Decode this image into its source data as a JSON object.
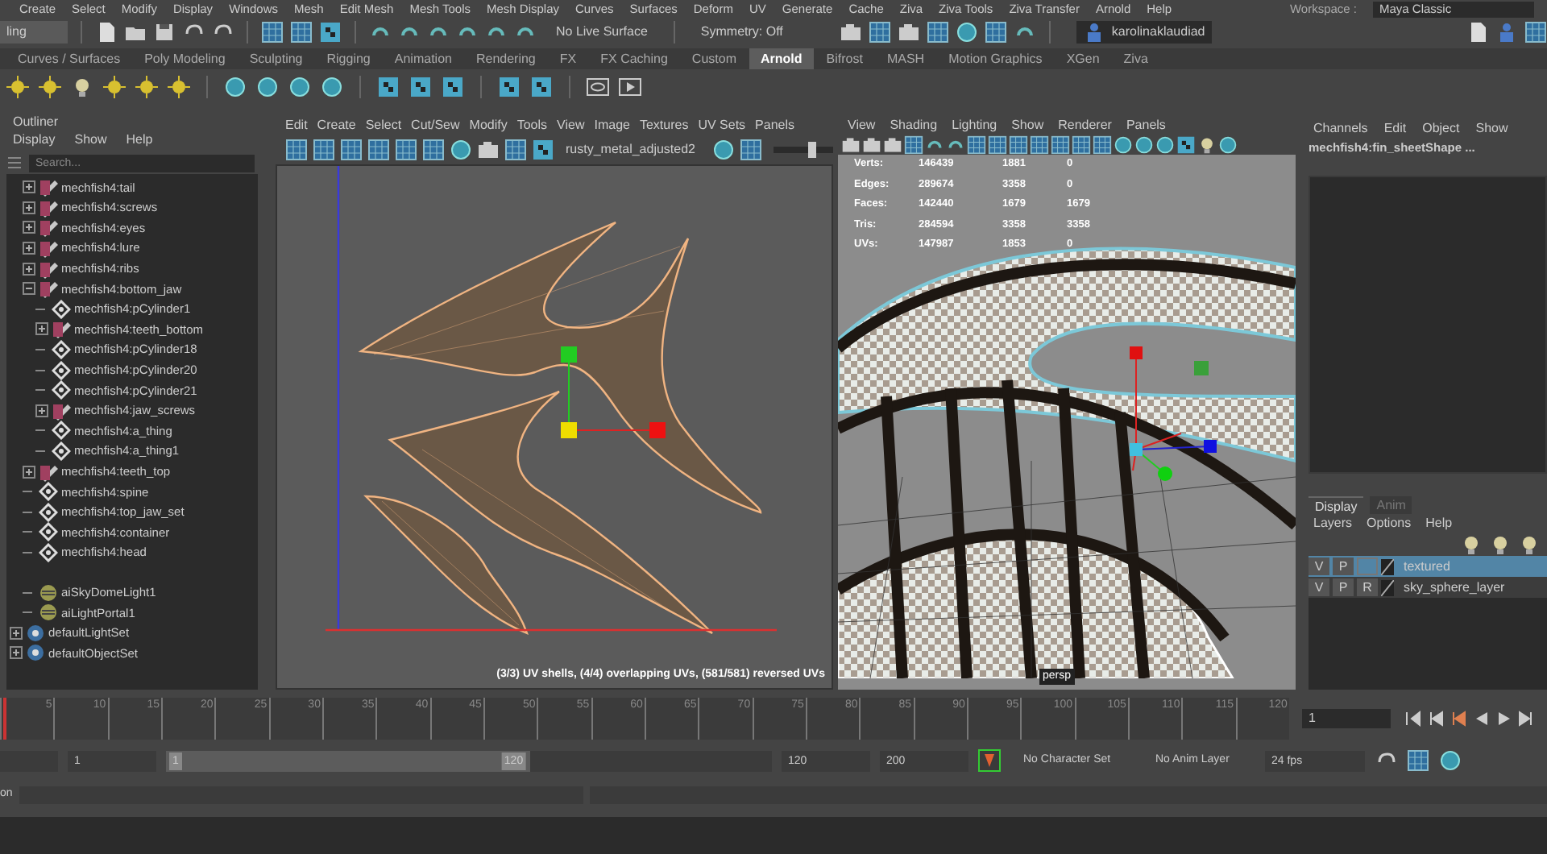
{
  "menu_bar": {
    "items": [
      "Create",
      "Select",
      "Modify",
      "Display",
      "Windows",
      "Mesh",
      "Edit Mesh",
      "Mesh Tools",
      "Mesh Display",
      "Curves",
      "Surfaces",
      "Deform",
      "UV",
      "Generate",
      "Cache",
      "Ziva",
      "Ziva Tools",
      "Ziva Transfer",
      "Arnold",
      "Help"
    ],
    "workspace_label": "Workspace :",
    "workspace": "Maya Classic"
  },
  "status_line": {
    "mode": "ling",
    "live_surface": "No Live Surface",
    "symmetry": "Symmetry: Off",
    "user": "karolinaklaudiad"
  },
  "shelf_tabs": [
    {
      "label": "Curves / Surfaces",
      "selected": false
    },
    {
      "label": "Poly Modeling",
      "selected": false
    },
    {
      "label": "Sculpting",
      "selected": false
    },
    {
      "label": "Rigging",
      "selected": false
    },
    {
      "label": "Animation",
      "selected": false
    },
    {
      "label": "Rendering",
      "selected": false
    },
    {
      "label": "FX",
      "selected": false
    },
    {
      "label": "FX Caching",
      "selected": false
    },
    {
      "label": "Custom",
      "selected": false
    },
    {
      "label": "Arnold",
      "selected": true
    },
    {
      "label": "Bifrost",
      "selected": false
    },
    {
      "label": "MASH",
      "selected": false
    },
    {
      "label": "Motion Graphics",
      "selected": false
    },
    {
      "label": "XGen",
      "selected": false
    },
    {
      "label": "Ziva",
      "selected": false
    }
  ],
  "outliner": {
    "title": "Outliner",
    "menu": [
      "Display",
      "Show",
      "Help"
    ],
    "search": {
      "placeholder": "Search..."
    },
    "items": [
      {
        "label": "mechfish4:tail",
        "kind": "group"
      },
      {
        "label": "mechfish4:screws",
        "kind": "group"
      },
      {
        "label": "mechfish4:eyes",
        "kind": "group"
      },
      {
        "label": "mechfish4:lure",
        "kind": "group"
      },
      {
        "label": "mechfish4:ribs",
        "kind": "group"
      },
      {
        "label": "mechfish4:bottom_jaw",
        "kind": "group",
        "expanded": true,
        "children": [
          {
            "label": "mechfish4:pCylinder1",
            "kind": "mesh"
          },
          {
            "label": "mechfish4:teeth_bottom",
            "kind": "group"
          },
          {
            "label": "mechfish4:pCylinder18",
            "kind": "mesh"
          },
          {
            "label": "mechfish4:pCylinder20",
            "kind": "mesh"
          },
          {
            "label": "mechfish4:pCylinder21",
            "kind": "mesh"
          },
          {
            "label": "mechfish4:jaw_screws",
            "kind": "group"
          },
          {
            "label": "mechfish4:a_thing",
            "kind": "mesh"
          },
          {
            "label": "mechfish4:a_thing1",
            "kind": "mesh"
          }
        ]
      },
      {
        "label": "mechfish4:teeth_top",
        "kind": "group"
      },
      {
        "label": "mechfish4:spine",
        "kind": "mesh"
      },
      {
        "label": "mechfish4:top_jaw_set",
        "kind": "mesh"
      },
      {
        "label": "mechfish4:container",
        "kind": "mesh"
      },
      {
        "label": "mechfish4:head",
        "kind": "mesh"
      }
    ],
    "root_items": [
      {
        "label": "aiSkyDomeLight1",
        "kind": "light"
      },
      {
        "label": "aiLightPortal1",
        "kind": "light"
      },
      {
        "label": "defaultLightSet",
        "kind": "set"
      },
      {
        "label": "defaultObjectSet",
        "kind": "set"
      }
    ]
  },
  "uv_editor": {
    "menu": [
      "Edit",
      "Create",
      "Select",
      "Cut/Sew",
      "Modify",
      "Tools",
      "View",
      "Image",
      "Textures",
      "UV Sets",
      "Panels"
    ],
    "texture": "rusty_metal_adjusted2",
    "exposure_slider": {
      "level": 0.65
    },
    "status": "(3/3) UV shells, (4/4) overlapping UVs, (581/581) reversed UVs"
  },
  "viewport": {
    "menu": [
      "View",
      "Shading",
      "Lighting",
      "Show",
      "Renderer",
      "Panels"
    ],
    "hud": [
      {
        "label": "Verts:",
        "values": [
          "146439",
          "1881",
          "0"
        ]
      },
      {
        "label": "Edges:",
        "values": [
          "289674",
          "3358",
          "0"
        ]
      },
      {
        "label": "Faces:",
        "values": [
          "142440",
          "1679",
          "1679"
        ]
      },
      {
        "label": "Tris:",
        "values": [
          "284594",
          "3358",
          "3358"
        ]
      },
      {
        "label": "UVs:",
        "values": [
          "147987",
          "1853",
          "0"
        ]
      }
    ],
    "camera": "persp"
  },
  "channel_box": {
    "menu": [
      "Channels",
      "Edit",
      "Object",
      "Show"
    ],
    "object": "mechfish4:fin_sheetShape ..."
  },
  "layer_editor": {
    "tabs": [
      {
        "label": "Display",
        "selected": true
      },
      {
        "label": "Anim",
        "selected": false
      }
    ],
    "menu": [
      "Layers",
      "Options",
      "Help"
    ],
    "layers": [
      {
        "visible": "V",
        "playback": "P",
        "name": "textured",
        "selected": true
      },
      {
        "visible": "V",
        "playback": "P",
        "render": "R",
        "name": "sky_sphere_layer",
        "selected": false
      }
    ]
  },
  "time_slider": {
    "ticks": [
      "5",
      "10",
      "15",
      "20",
      "25",
      "30",
      "35",
      "40",
      "45",
      "50",
      "55",
      "60",
      "65",
      "70",
      "75",
      "80",
      "85",
      "90",
      "95",
      "100",
      "105",
      "110",
      "115",
      "120"
    ],
    "current_frame": "1",
    "level": 0
  },
  "range_slider": {
    "start": "1",
    "inner_start": "1",
    "inner_end": "120",
    "end": "120",
    "max": "200",
    "level": 0.6,
    "character_set": "No Character Set",
    "anim_layer": "No Anim Layer",
    "fps": "24 fps"
  },
  "command_line": {
    "label": "on"
  }
}
